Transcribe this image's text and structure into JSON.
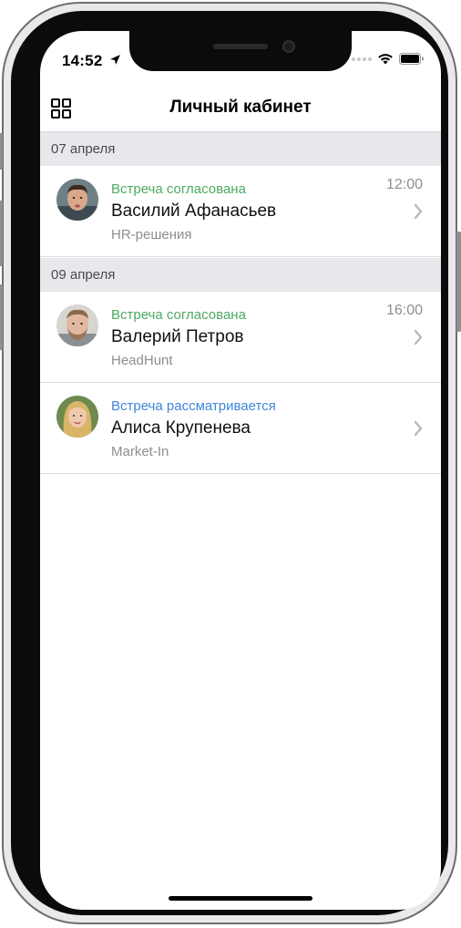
{
  "status_bar": {
    "time": "14:52",
    "location_icon": "location-arrow-icon",
    "wifi_icon": "wifi-icon",
    "battery_icon": "battery-icon"
  },
  "navbar": {
    "title": "Личный кабинет",
    "menu_icon": "grid-icon"
  },
  "sections": [
    {
      "date": "07 апреля",
      "items": [
        {
          "status": "Встреча согласована",
          "status_color": "#4caa61",
          "name": "Василий Афанасьев",
          "company": "HR-решения",
          "time": "12:00"
        }
      ]
    },
    {
      "date": "09 апреля",
      "items": [
        {
          "status": "Встреча согласована",
          "status_color": "#4caa61",
          "name": "Валерий Петров",
          "company": "HeadHunt",
          "time": "16:00"
        },
        {
          "status": "Встреча рассматривается",
          "status_color": "#3f86d9",
          "name": "Алиса Крупенева",
          "company": "Market-In",
          "time": ""
        }
      ]
    }
  ]
}
